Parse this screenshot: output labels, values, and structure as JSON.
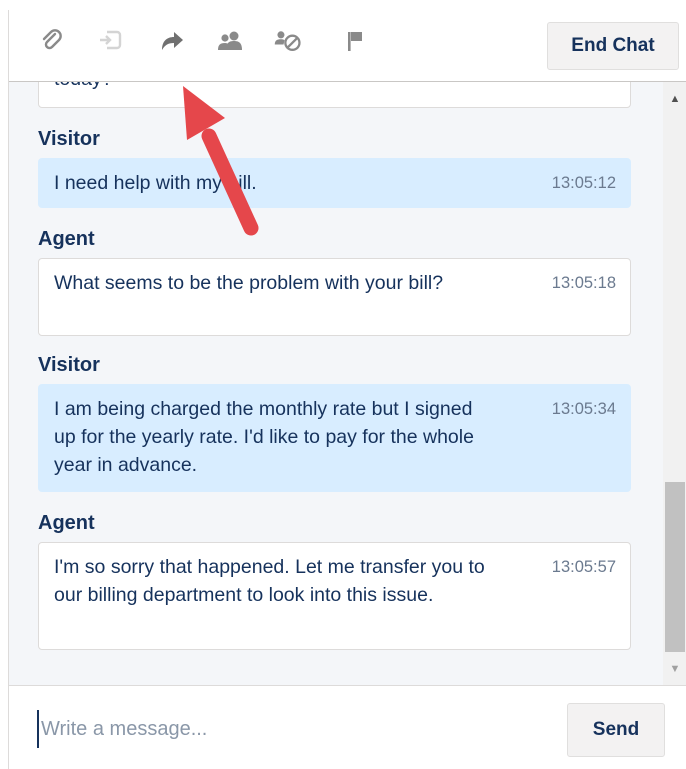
{
  "toolbar": {
    "icons": [
      "attachment-icon",
      "transfer-file-icon",
      "transfer-arrow-icon",
      "conference-icon",
      "block-visitor-icon",
      "flag-icon"
    ],
    "end_chat_label": "End Chat"
  },
  "chat": {
    "clipped_text": "today?",
    "messages": [
      {
        "sender": "Visitor",
        "text": "I need help with my bill.",
        "time": "13:05:12"
      },
      {
        "sender": "Agent",
        "text": "What seems to be the problem with your bill?",
        "time": "13:05:18"
      },
      {
        "sender": "Visitor",
        "text": "I am being charged the monthly rate but I signed up for the yearly rate. I'd like to pay for the whole year in advance.",
        "time": "13:05:34"
      },
      {
        "sender": "Agent",
        "text": "I'm so sorry that happened. Let me transfer you to our billing department to look into this issue.",
        "time": "13:05:57"
      }
    ]
  },
  "composer": {
    "placeholder": "Write a message...",
    "send_label": "Send"
  },
  "colors": {
    "visitor_bubble": "#d8edff",
    "agent_bubble": "#ffffff",
    "chat_background": "#f4f6f9",
    "annotation_arrow": "#e5474b",
    "icon_gray": "#8a8a8a"
  }
}
